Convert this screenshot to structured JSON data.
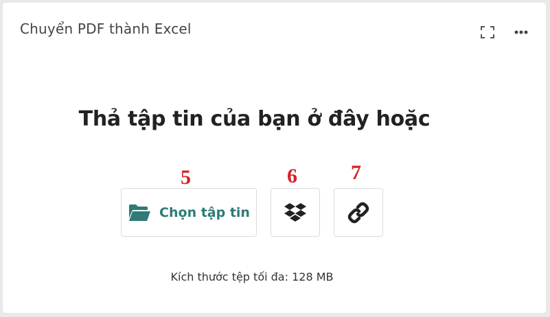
{
  "tool": {
    "title": "Chuyển PDF thành Excel"
  },
  "header_icons": {
    "fullscreen": "fullscreen-icon",
    "more": "more-options-icon"
  },
  "dropzone": {
    "heading": "Thả tập tin của bạn ở đây hoặc",
    "choose_file_label": "Chọn tập tin",
    "choose_file_icon": "folder-open-icon",
    "dropbox_icon": "dropbox-icon",
    "url_icon": "link-icon",
    "max_size_text": "Kích thước tệp tối đa: 128 MB"
  },
  "annotations": {
    "label_5": "5",
    "label_6": "6",
    "label_7": "7"
  },
  "colors": {
    "accent": "#2e7b77",
    "annotation": "#d62027",
    "background": "#e9e9e9",
    "card": "#ffffff"
  }
}
